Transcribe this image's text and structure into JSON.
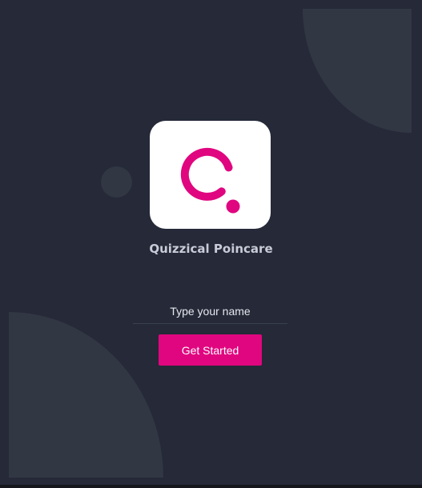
{
  "app": {
    "name": "Quizzical Poincare",
    "logo_icon": "quizzical-q-logo-icon"
  },
  "form": {
    "name_placeholder": "Type your name",
    "name_value": "",
    "start_label": "Get Started"
  },
  "colors": {
    "background": "#252938",
    "decoration": "#323744",
    "accent": "#e0067f",
    "logo_background": "#ffffff",
    "app_name_text": "#c9cbd8"
  }
}
